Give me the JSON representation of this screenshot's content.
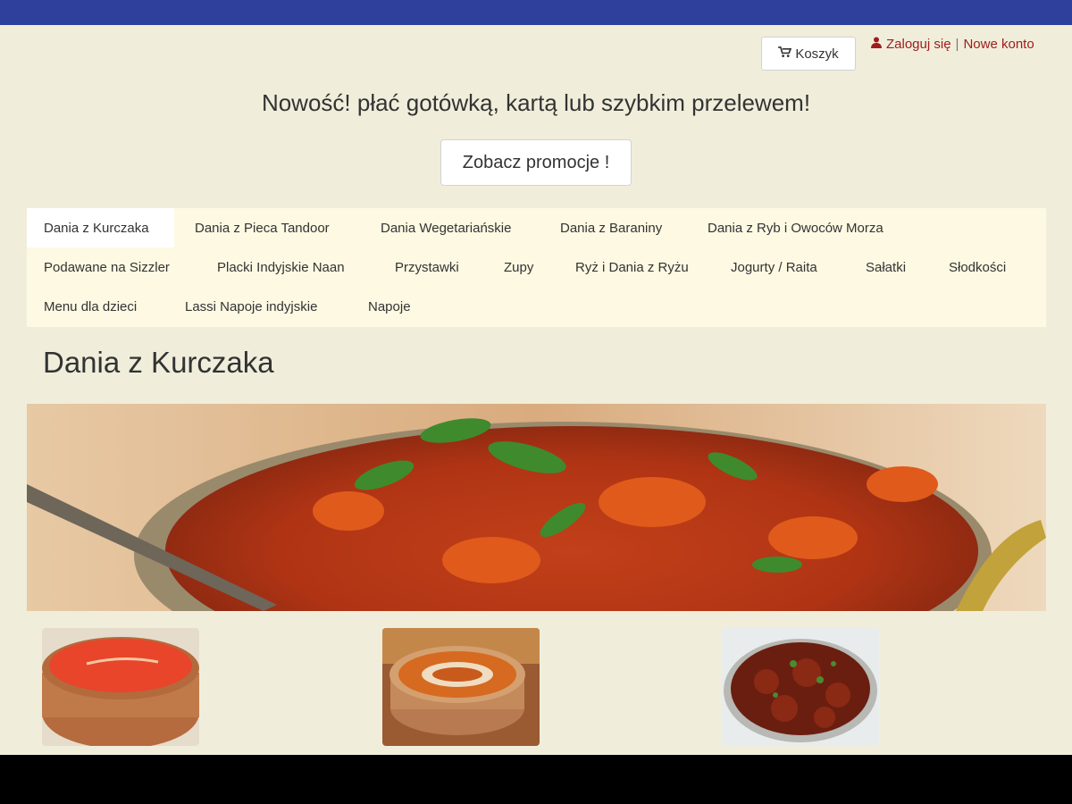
{
  "header": {
    "cart_label": "Koszyk",
    "login_label": "Zaloguj się",
    "separator": "|",
    "register_label": "Nowe konto",
    "icons": {
      "cart": "cart-icon",
      "user": "user-icon"
    },
    "colors": {
      "topbar": "#2e3f9c",
      "account_link": "#a01c1c"
    }
  },
  "promo": {
    "text": "Nowość! płać gotówką, kartą lub szybkim przelewem!",
    "button_label": "Zobacz promocje !"
  },
  "nav": {
    "items": [
      {
        "label": "Dania z Kurczaka",
        "active": true
      },
      {
        "label": "Dania z Pieca Tandoor"
      },
      {
        "label": "Dania Wegetariańskie"
      },
      {
        "label": "Dania z Baraniny"
      },
      {
        "label": "Dania z Ryb i Owoców Morza"
      },
      {
        "label": "Podawane na Sizzler"
      },
      {
        "label": "Placki Indyjskie Naan"
      },
      {
        "label": "Przystawki"
      },
      {
        "label": "Zupy"
      },
      {
        "label": "Ryż i Dania z Ryżu"
      },
      {
        "label": "Jogurty / Raita"
      },
      {
        "label": "Sałatki"
      },
      {
        "label": "Słodkości"
      },
      {
        "label": "Menu dla dzieci"
      },
      {
        "label": "Lassi Napoje indyjskie"
      },
      {
        "label": "Napoje"
      }
    ]
  },
  "main": {
    "title": "Dania z Kurczaka"
  }
}
